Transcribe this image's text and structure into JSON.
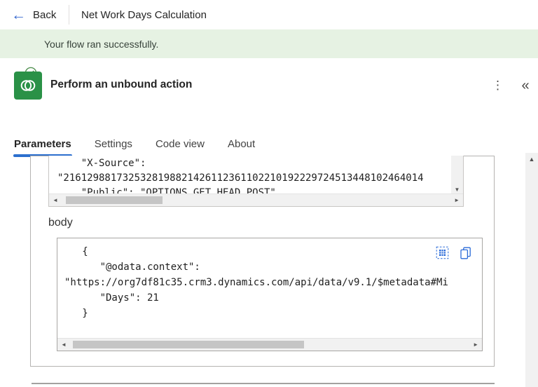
{
  "topbar": {
    "back_label": "Back",
    "title": "Net Work Days Calculation"
  },
  "banner": {
    "message": "Your flow ran successfully."
  },
  "action": {
    "title": "Perform an unbound action",
    "icon": "dataverse-icon",
    "more_glyph": "⋮",
    "collapse_glyph": "«"
  },
  "tabs": {
    "parameters": "Parameters",
    "settings": "Settings",
    "code_view": "Code view",
    "about": "About"
  },
  "headers_block": {
    "line1": "    \"X-Source\":",
    "line2": "\"2161298817325328198821426112361102210192229724513448102464014",
    "line3": "    \"Public\": \"OPTIONS,GET,HEAD,POST\""
  },
  "body_section": {
    "label": "body",
    "line1": "   {",
    "line2": "      \"@odata.context\":",
    "line3": "\"https://org7df81c35.crm3.dynamics.com/api/data/v9.1/$metadata#Mi",
    "line4": "      \"Days\": 21",
    "line5": "   }"
  },
  "scrollbars": {
    "up_glyph": "▲",
    "down_glyph": "▼",
    "left_glyph": "◄",
    "right_glyph": "►"
  },
  "colors": {
    "accent_blue": "#2c6fce",
    "dataverse_green": "#2a9147",
    "success_bg": "#e6f2e3",
    "success_icon": "#539253"
  }
}
